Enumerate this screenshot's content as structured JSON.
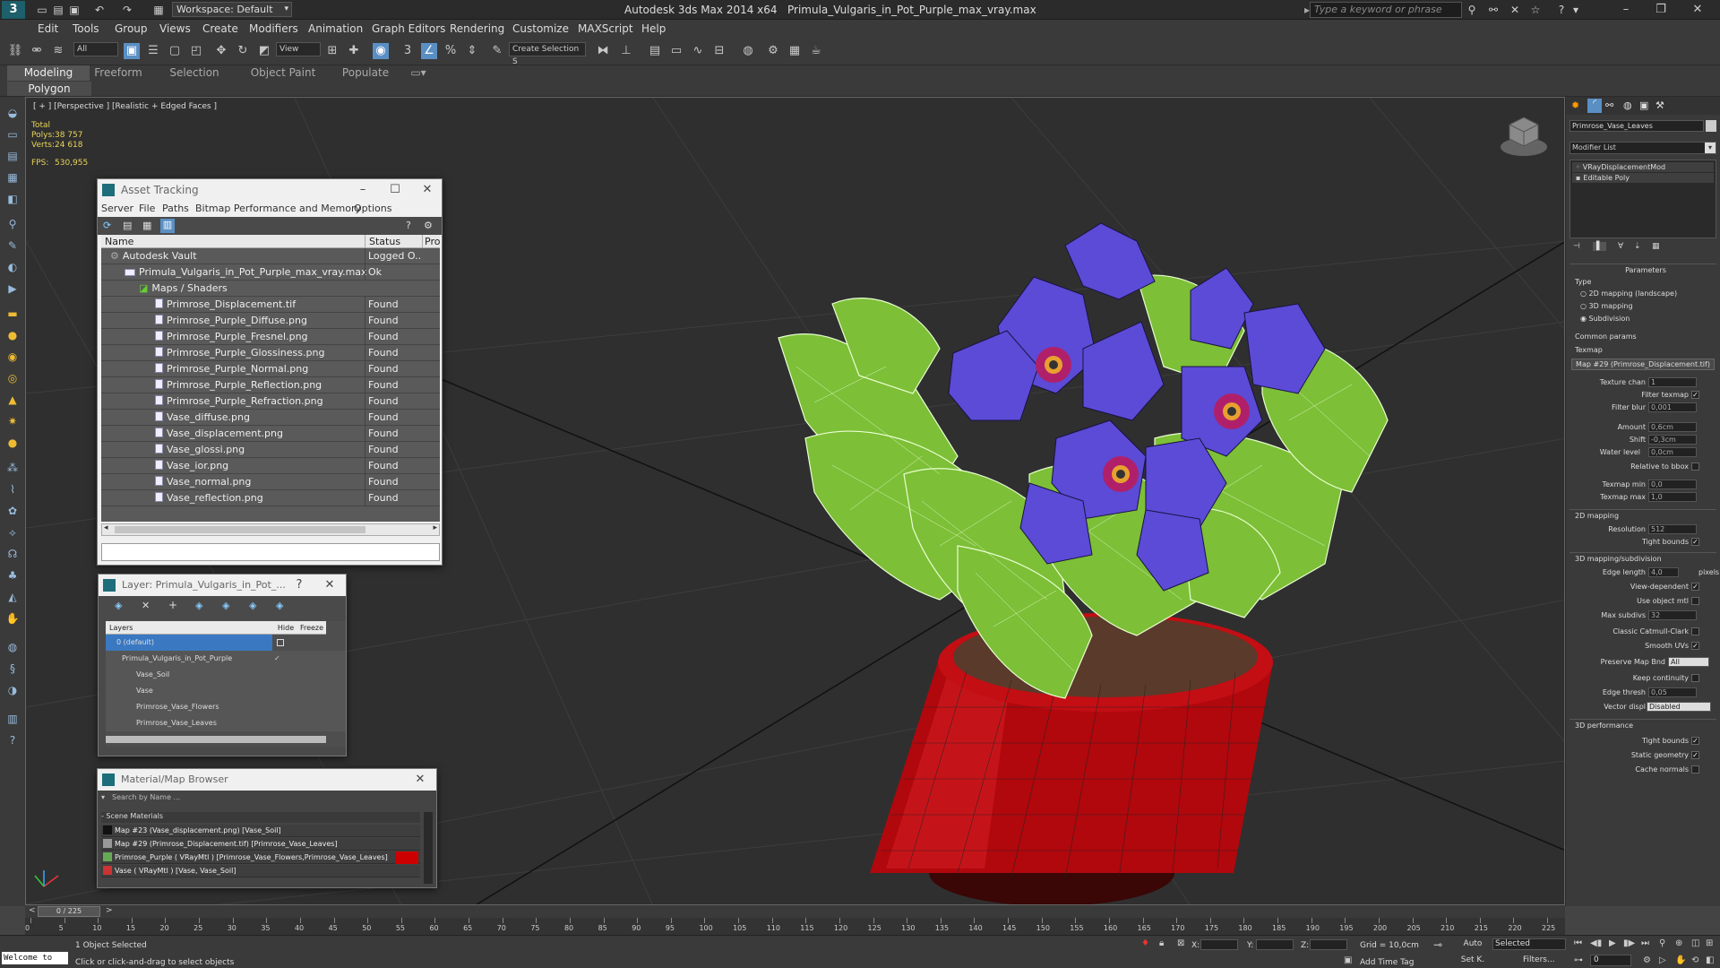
{
  "titlebar": {
    "workspace": "Workspace: Default",
    "app_name": "Autodesk 3ds Max  2014 x64",
    "file_name": "Primula_Vulgaris_in_Pot_Purple_max_vray.max",
    "search_placeholder": "Type a keyword or phrase",
    "logo": "3"
  },
  "menu": [
    "Edit",
    "Tools",
    "Group",
    "Views",
    "Create",
    "Modifiers",
    "Animation",
    "Graph Editors",
    "Rendering",
    "Customize",
    "MAXScript",
    "Help"
  ],
  "toolbar": {
    "filter": "All",
    "refcoord": "View",
    "selset": "Create Selection S"
  },
  "ribbon": {
    "tabs": [
      "Modeling",
      "Freeform",
      "Selection",
      "Object Paint",
      "Populate"
    ],
    "sub": "Polygon Modeling"
  },
  "viewport": {
    "label": "[ + ] [Perspective ] [Realistic + Edged Faces ]",
    "total_label": "Total",
    "polys_label": "Polys:",
    "polys_value": "38 757",
    "verts_label": "Verts:",
    "verts_value": "24 618",
    "fps_label": "FPS:",
    "fps_value": "530,955"
  },
  "asset_tracking": {
    "title": "Asset Tracking",
    "menu": [
      "Server",
      "File",
      "Paths",
      "Bitmap Performance and Memory",
      "Options"
    ],
    "col_name": "Name",
    "col_status": "Status",
    "col_pro": "Pro",
    "rows": [
      {
        "name": "Autodesk Vault",
        "status": "Logged O..."
      },
      {
        "name": "Primula_Vulgaris_in_Pot_Purple_max_vray.max",
        "status": "Ok"
      },
      {
        "name": "Maps / Shaders",
        "status": ""
      },
      {
        "name": "Primrose_Displacement.tif",
        "status": "Found"
      },
      {
        "name": "Primrose_Purple_Diffuse.png",
        "status": "Found"
      },
      {
        "name": "Primrose_Purple_Fresnel.png",
        "status": "Found"
      },
      {
        "name": "Primrose_Purple_Glossiness.png",
        "status": "Found"
      },
      {
        "name": "Primrose_Purple_Normal.png",
        "status": "Found"
      },
      {
        "name": "Primrose_Purple_Reflection.png",
        "status": "Found"
      },
      {
        "name": "Primrose_Purple_Refraction.png",
        "status": "Found"
      },
      {
        "name": "Vase_diffuse.png",
        "status": "Found"
      },
      {
        "name": "Vase_displacement.png",
        "status": "Found"
      },
      {
        "name": "Vase_glossi.png",
        "status": "Found"
      },
      {
        "name": "Vase_ior.png",
        "status": "Found"
      },
      {
        "name": "Vase_normal.png",
        "status": "Found"
      },
      {
        "name": "Vase_reflection.png",
        "status": "Found"
      }
    ]
  },
  "layer": {
    "title": "Layer: Primula_Vulgaris_in_Pot_...",
    "help": "?",
    "col_layers": "Layers",
    "col_hide": "Hide",
    "col_freeze": "Freeze",
    "rows": [
      {
        "name": "0 (default)"
      },
      {
        "name": "Primula_Vulgaris_in_Pot_Purple"
      },
      {
        "name": "Vase_Soil"
      },
      {
        "name": "Vase"
      },
      {
        "name": "Primrose_Vase_Flowers"
      },
      {
        "name": "Primrose_Vase_Leaves"
      }
    ]
  },
  "material": {
    "title": "Material/Map Browser",
    "search": "Search by Name ...",
    "section": "- Scene Materials",
    "rows": [
      "Map #23 (Vase_displacement.png) [Vase_Soil]",
      "Map #29 (Primrose_Displacement.tif) [Primrose_Vase_Leaves]",
      "Primrose_Purple ( VRayMtl ) [Primrose_Vase_Flowers,Primrose_Vase_Leaves]",
      "Vase ( VRayMtl ) [Vase, Vase_Soil]"
    ]
  },
  "cmd": {
    "object_name": "Primrose_Vase_Leaves",
    "modifier_list": "Modifier List",
    "stack": [
      "VRayDisplacementMod",
      "Editable Poly"
    ],
    "rollout": "Parameters",
    "type_label": "Type",
    "types": [
      "2D mapping (landscape)",
      "3D mapping",
      "Subdivision"
    ],
    "common": "Common params",
    "texmap": "Texmap",
    "texmap_value": "Map #29 (Primrose_Displacement.tif)",
    "params": [
      {
        "label": "Texture chan",
        "value": "1"
      },
      {
        "label": "Filter texmap",
        "check": "✓"
      },
      {
        "label": "Filter blur",
        "value": "0,001"
      },
      {
        "label": "Amount",
        "value": "0,6cm"
      },
      {
        "label": "Shift",
        "value": "-0,3cm"
      },
      {
        "label": "Water level",
        "value": "0,0cm"
      },
      {
        "label": "Relative to bbox",
        "check": ""
      },
      {
        "label": "Texmap min",
        "value": "0,0"
      },
      {
        "label": "Texmap max",
        "value": "1,0"
      }
    ],
    "sec_2d": "2D mapping",
    "params2d": [
      {
        "label": "Resolution",
        "value": "512"
      },
      {
        "label": "Tight bounds",
        "check": "✓"
      }
    ],
    "sec_3d": "3D mapping/subdivision",
    "params3d": [
      {
        "label": "Edge length",
        "value": "4,0",
        "suffix": "pixels"
      },
      {
        "label": "View-dependent",
        "check": "✓"
      },
      {
        "label": "Use object mtl",
        "check": ""
      },
      {
        "label": "Max subdivs",
        "value": "32"
      },
      {
        "label": "Classic Catmull-Clark",
        "check": ""
      },
      {
        "label": "Smooth UVs",
        "check": "✓"
      },
      {
        "label": "Preserve Map Bnd",
        "value": "All"
      },
      {
        "label": "Keep continuity",
        "check": ""
      },
      {
        "label": "Edge thresh",
        "value": "0,05"
      },
      {
        "label": "Vector displ",
        "value": "Disabled"
      }
    ],
    "sec_perf": "3D performance",
    "paramsperf": [
      {
        "label": "Tight bounds",
        "check": "✓"
      },
      {
        "label": "Static geometry",
        "check": "✓"
      },
      {
        "label": "Cache normals",
        "check": ""
      }
    ]
  },
  "timeline": {
    "frame": "0 / 225",
    "ticks": [
      "0",
      "5",
      "10",
      "15",
      "20",
      "25",
      "30",
      "35",
      "40",
      "45",
      "50",
      "55",
      "60",
      "65",
      "70",
      "75",
      "80",
      "85",
      "90",
      "95",
      "100",
      "105",
      "110",
      "115",
      "120",
      "125",
      "130",
      "135",
      "140",
      "145",
      "150",
      "155",
      "160",
      "165",
      "170",
      "175",
      "180",
      "185",
      "190",
      "195",
      "200",
      "205",
      "210",
      "215",
      "220",
      "225"
    ]
  },
  "status": {
    "welcome": "Welcome to",
    "selected": "1 Object Selected",
    "hint": "Click or click-and-drag to select objects",
    "x": "X:",
    "y": "Y:",
    "z": "Z:",
    "grid": "Grid = 10,0cm",
    "auto": "Auto",
    "setk": "Set K.",
    "selected_dd": "Selected",
    "filters": "Filters...",
    "add_time_tag": "Add Time Tag",
    "frame": "0"
  }
}
